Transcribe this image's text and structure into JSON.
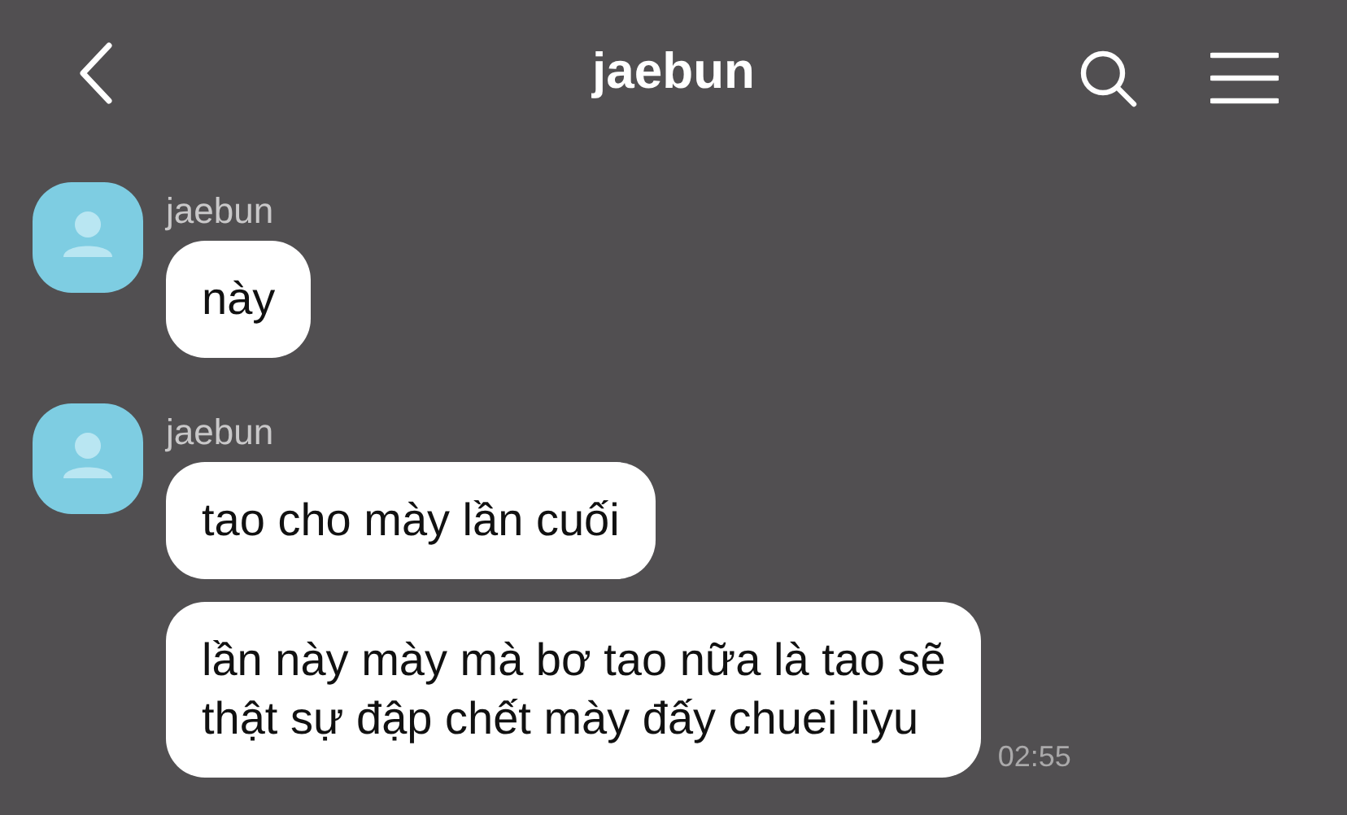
{
  "header": {
    "title": "jaebun"
  },
  "groups": [
    {
      "sender": "jaebun",
      "messages": [
        {
          "text": "này"
        }
      ]
    },
    {
      "sender": "jaebun",
      "messages": [
        {
          "text": "tao cho mày lần cuối"
        },
        {
          "text": "lần này mày mà bơ tao nữa là tao sẽ\nthật sự đập chết mày đấy chuei liyu",
          "time": "02:55"
        }
      ]
    }
  ]
}
